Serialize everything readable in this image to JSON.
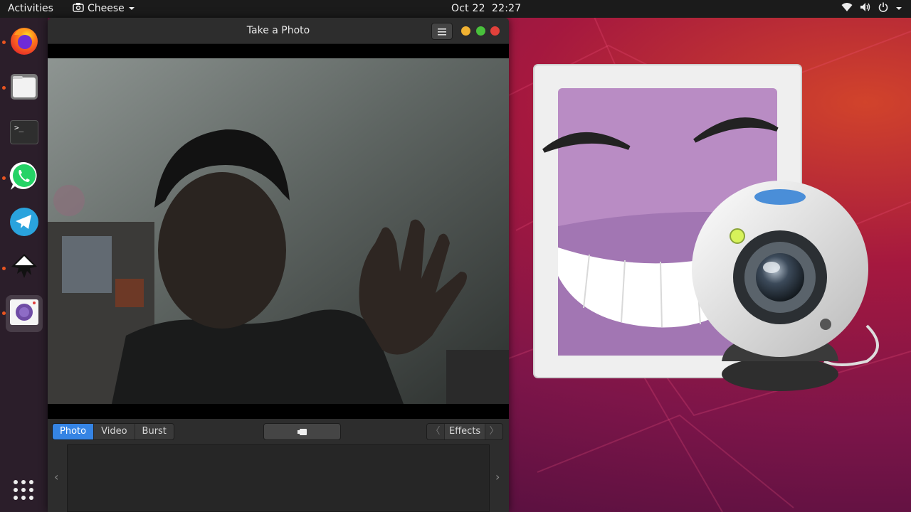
{
  "topbar": {
    "activities": "Activities",
    "app_name": "Cheese",
    "date": "Oct 22",
    "time": "22:27"
  },
  "dock": {
    "apps": [
      "firefox-icon",
      "files-icon",
      "terminal-icon",
      "whatsapp-icon",
      "telegram-icon",
      "inkscape-icon",
      "cheese-icon"
    ],
    "show_apps_icon": "grid-icon",
    "terminal_glyph": ">_"
  },
  "window": {
    "title": "Take a Photo",
    "menu_icon": "hamburger-icon",
    "modes": [
      "Photo",
      "Video",
      "Burst"
    ],
    "selected_mode": "Photo",
    "effects_label": "Effects",
    "prev_glyph": "〈",
    "next_glyph": "〉",
    "scroll_left_glyph": "‹",
    "scroll_right_glyph": "›"
  },
  "colors": {
    "accent": "#3584e4",
    "ubuntu_orange": "#e95420",
    "close": "#e2413b",
    "minimize": "#f1b232",
    "maximize": "#49c13c"
  }
}
